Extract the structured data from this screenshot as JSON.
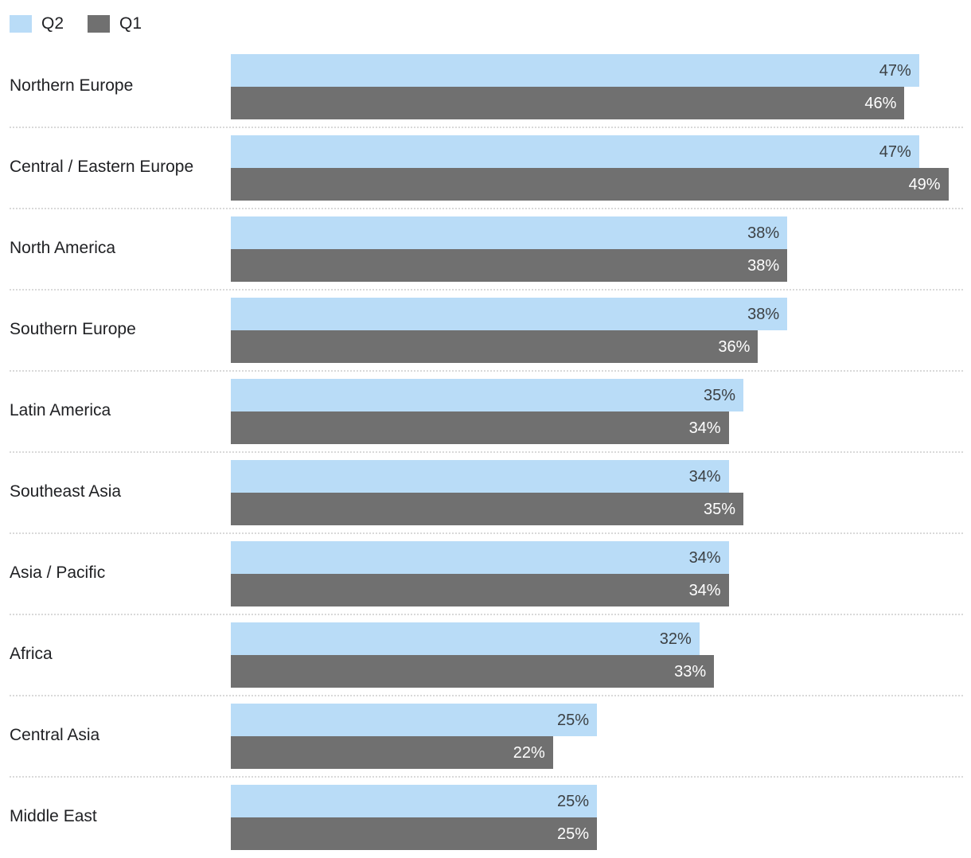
{
  "legend": {
    "items": [
      {
        "label": "Q2",
        "color": "#b9dcf7",
        "swatch_name": "legend-swatch-q2"
      },
      {
        "label": "Q1",
        "color": "#707070",
        "swatch_name": "legend-swatch-q1"
      }
    ]
  },
  "chart_data": {
    "type": "bar",
    "title": "",
    "subtitle": "",
    "xlabel": "",
    "ylabel": "",
    "orientation": "horizontal",
    "grid": false,
    "legend_position": "top-left",
    "value_suffix": "%",
    "xlim": [
      0,
      50
    ],
    "colors": {
      "Q2": "#b9dcf7",
      "Q1": "#707070"
    },
    "categories": [
      "Northern Europe",
      "Central / Eastern Europe",
      "North America",
      "Southern Europe",
      "Latin America",
      "Southeast Asia",
      "Asia / Pacific",
      "Africa",
      "Central Asia",
      "Middle East"
    ],
    "series": [
      {
        "name": "Q2",
        "values": [
          47,
          47,
          38,
          38,
          35,
          34,
          34,
          32,
          25,
          25
        ],
        "labels": [
          "47%",
          "47%",
          "38%",
          "38%",
          "35%",
          "34%",
          "34%",
          "32%",
          "25%",
          "25%"
        ]
      },
      {
        "name": "Q1",
        "values": [
          46,
          49,
          38,
          36,
          34,
          35,
          34,
          33,
          22,
          25
        ],
        "labels": [
          "46%",
          "49%",
          "38%",
          "36%",
          "34%",
          "35%",
          "34%",
          "33%",
          "22%",
          "25%"
        ]
      }
    ]
  }
}
